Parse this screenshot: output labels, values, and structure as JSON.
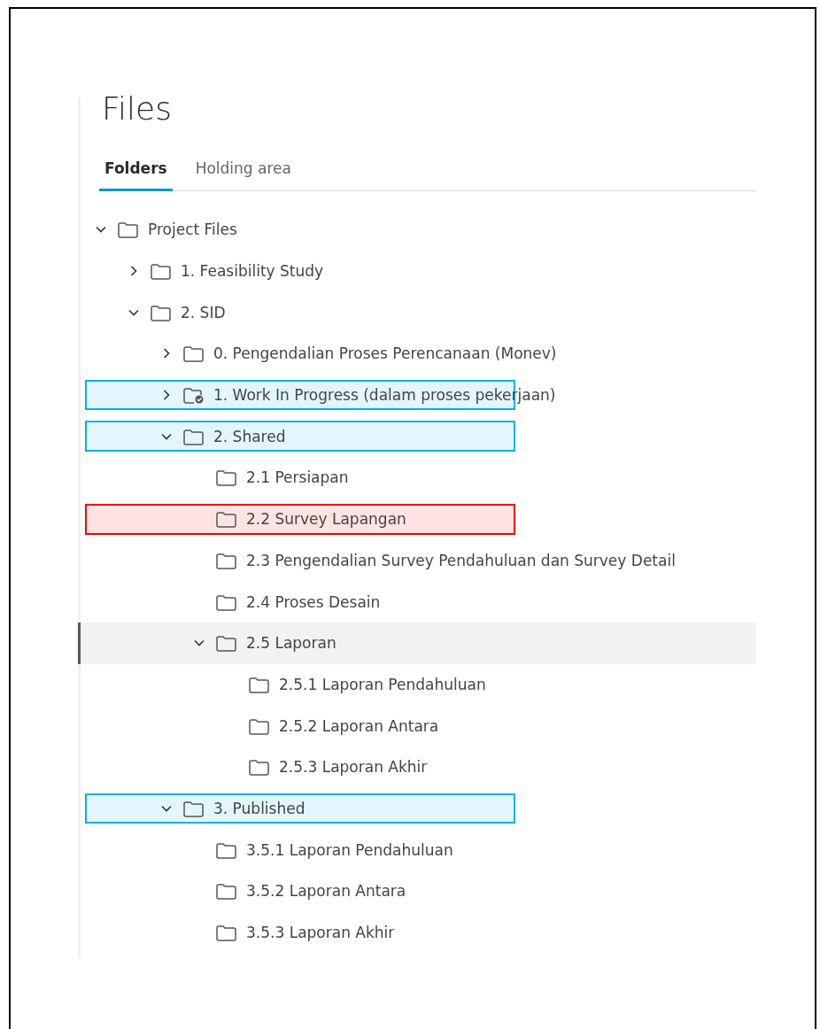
{
  "title": "Files",
  "tabs": [
    {
      "label": "Folders",
      "selected": true
    },
    {
      "label": "Holding area",
      "selected": false
    }
  ],
  "tree": [
    {
      "label": "Project Files",
      "kind": "folder",
      "expanded": true,
      "selected": false,
      "children": [
        {
          "label": "1. Feasibility Study",
          "kind": "folder",
          "expanded": false,
          "selected": false
        },
        {
          "label": "2. SID",
          "kind": "folder",
          "expanded": true,
          "selected": false,
          "children": [
            {
              "label": "0. Pengendalian Proses Perencanaan (Monev)",
              "kind": "folder",
              "expanded": false,
              "selected": false
            },
            {
              "label": "1. Work In Progress (dalam proses pekerjaan)",
              "kind": "checked-folder",
              "expanded": false,
              "selected": false,
              "color": "#00b0f0"
            },
            {
              "label": "2. Shared",
              "kind": "folder",
              "expanded": true,
              "selected": false,
              "color": "#00b0f0",
              "children": [
                {
                  "label": "2.1 Persiapan",
                  "kind": "folder",
                  "selected": false
                },
                {
                  "label": "2.2 Survey Lapangan",
                  "kind": "folder",
                  "selected": false,
                  "color": "#ff0000"
                },
                {
                  "label": "2.3 Pengendalian Survey Pendahuluan dan Survey Detail",
                  "kind": "folder",
                  "selected": false
                },
                {
                  "label": "2.4 Proses Desain",
                  "kind": "folder",
                  "selected": false
                },
                {
                  "label": "2.5 Laporan",
                  "kind": "folder",
                  "expanded": true,
                  "selected": true,
                  "children": [
                    {
                      "label": "2.5.1 Laporan Pendahuluan",
                      "kind": "folder",
                      "selected": false
                    },
                    {
                      "label": "2.5.2 Laporan Antara",
                      "kind": "folder",
                      "selected": false
                    },
                    {
                      "label": "2.5.3 Laporan Akhir",
                      "kind": "folder",
                      "selected": false
                    }
                  ]
                }
              ]
            },
            {
              "label": "3. Published",
              "kind": "folder",
              "expanded": true,
              "selected": false,
              "color": "#00b0f0",
              "children": [
                {
                  "label": "3.5.1 Laporan Pendahuluan",
                  "kind": "folder",
                  "selected": false
                },
                {
                  "label": "3.5.2 Laporan Antara",
                  "kind": "folder",
                  "selected": false
                },
                {
                  "label": "3.5.3 Laporan Akhir",
                  "kind": "folder",
                  "selected": false
                }
              ]
            }
          ]
        }
      ]
    }
  ]
}
